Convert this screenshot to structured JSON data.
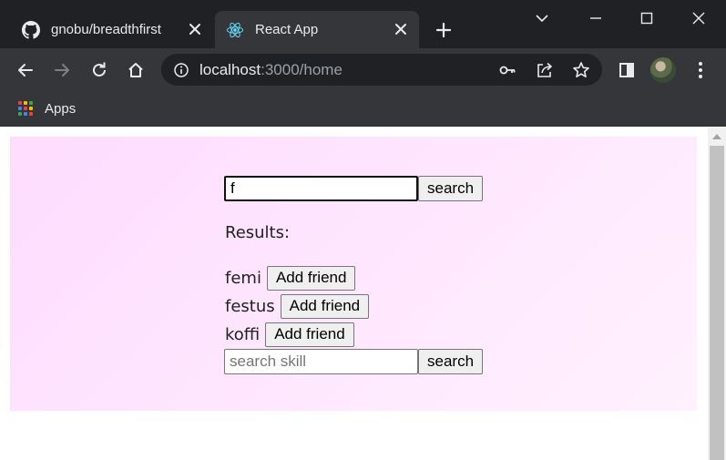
{
  "browser": {
    "tabs": [
      {
        "title": "gnobu/breadthfirst",
        "icon": "github-icon",
        "active": false
      },
      {
        "title": "React App",
        "icon": "react-icon",
        "active": true
      }
    ],
    "url_host": "localhost",
    "url_rest": ":3000/home",
    "bookmarks": [
      {
        "label": "Apps",
        "icon": "apps-grid-icon"
      }
    ]
  },
  "page": {
    "search": {
      "value": "f",
      "button_label": "search"
    },
    "results_label": "Results:",
    "friends": [
      {
        "name": "femi",
        "button_label": "Add friend"
      },
      {
        "name": "festus",
        "button_label": "Add friend"
      },
      {
        "name": "koffi",
        "button_label": "Add friend"
      }
    ],
    "skill_search": {
      "placeholder": "search skill",
      "value": "",
      "button_label": "search"
    }
  },
  "colors": {
    "chrome_frame": "#202124",
    "chrome_toolbar": "#35363a",
    "panel_gradient_start": "#fedcfe",
    "panel_gradient_end": "#fff1fe"
  }
}
